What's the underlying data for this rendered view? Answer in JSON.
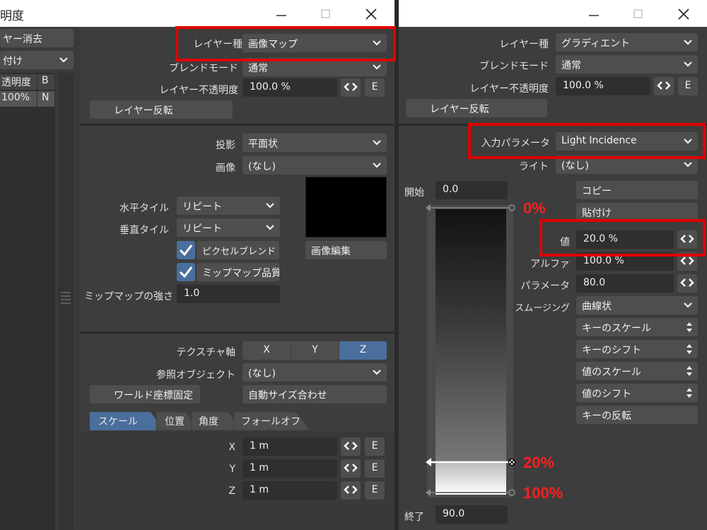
{
  "left_window": {
    "title_fragment": "明度",
    "side": {
      "clear_button": "ヤー消去",
      "dropdown": "付け",
      "header_opacity": "透明度",
      "header_b": "B",
      "row_opacity": "100%",
      "row_b": "N"
    },
    "top": {
      "layer_type_label": "レイヤー種",
      "layer_type_value": "画像マップ",
      "blend_mode_label": "ブレンドモード",
      "blend_mode_value": "通常",
      "opacity_label": "レイヤー不透明度",
      "opacity_value": "100.0 %",
      "invert_button": "レイヤー反転"
    },
    "image": {
      "projection_label": "投影",
      "projection_value": "平面状",
      "image_label": "画像",
      "image_value": "(なし)",
      "htile_label": "水平タイル",
      "htile_value": "リピート",
      "vtile_label": "垂直タイル",
      "vtile_value": "リピート",
      "pixel_blend": "ピクセルブレンド",
      "mipmap_quality": "ミップマップ品質",
      "mipmap_strength_label": "ミップマップの強さ",
      "mipmap_strength_value": "1.0",
      "edit_image_button": "画像編集"
    },
    "texture": {
      "axis_label": "テクスチャ軸",
      "axis_x": "X",
      "axis_y": "Y",
      "axis_z": "Z",
      "ref_object_label": "参照オブジェクト",
      "ref_object_value": "(なし)",
      "world_coords_button": "ワールド座標固定",
      "auto_size_button": "自動サイズ合わせ",
      "tabs": [
        "スケール",
        "位置",
        "角度",
        "フォールオフ"
      ],
      "x_label": "X",
      "x_value": "1 m",
      "y_label": "Y",
      "y_value": "1 m",
      "z_label": "Z",
      "z_value": "1 m"
    },
    "env_button": "E"
  },
  "right_window": {
    "top": {
      "layer_type_label": "レイヤー種",
      "layer_type_value": "グラディエント",
      "blend_mode_label": "ブレンドモード",
      "blend_mode_value": "通常",
      "opacity_label": "レイヤー不透明度",
      "opacity_value": "100.0 %",
      "invert_button": "レイヤー反転"
    },
    "gradient": {
      "input_param_label": "入力パラメータ",
      "input_param_value": "Light Incidence",
      "light_label": "ライト",
      "light_value": "(なし)",
      "start_label": "開始",
      "start_value": "0.0",
      "end_label": "終了",
      "end_value": "90.0",
      "copy_button": "コピー",
      "paste_button": "貼付け",
      "value_label": "値",
      "value_value": "20.0 %",
      "alpha_label": "アルファ",
      "alpha_value": "100.0 %",
      "param_label": "パラメータ",
      "param_value": "80.0",
      "smoothing_label": "スムージング",
      "smoothing_value": "曲線状",
      "key_scale": "キーのスケール",
      "key_shift": "キーのシフト",
      "value_scale": "値のスケール",
      "value_shift": "値のシフト",
      "key_invert": "キーの反転"
    },
    "env_button": "E"
  },
  "annotations": {
    "pct0": "0%",
    "pct20": "20%",
    "pct100": "100%"
  },
  "colors": {
    "highlight_red": "#e00000",
    "panel_bg": "#3d3d3d",
    "field_bg": "#2f2f2f",
    "control_bg": "#4e4e4e",
    "accent_blue": "#4a6f9c"
  }
}
